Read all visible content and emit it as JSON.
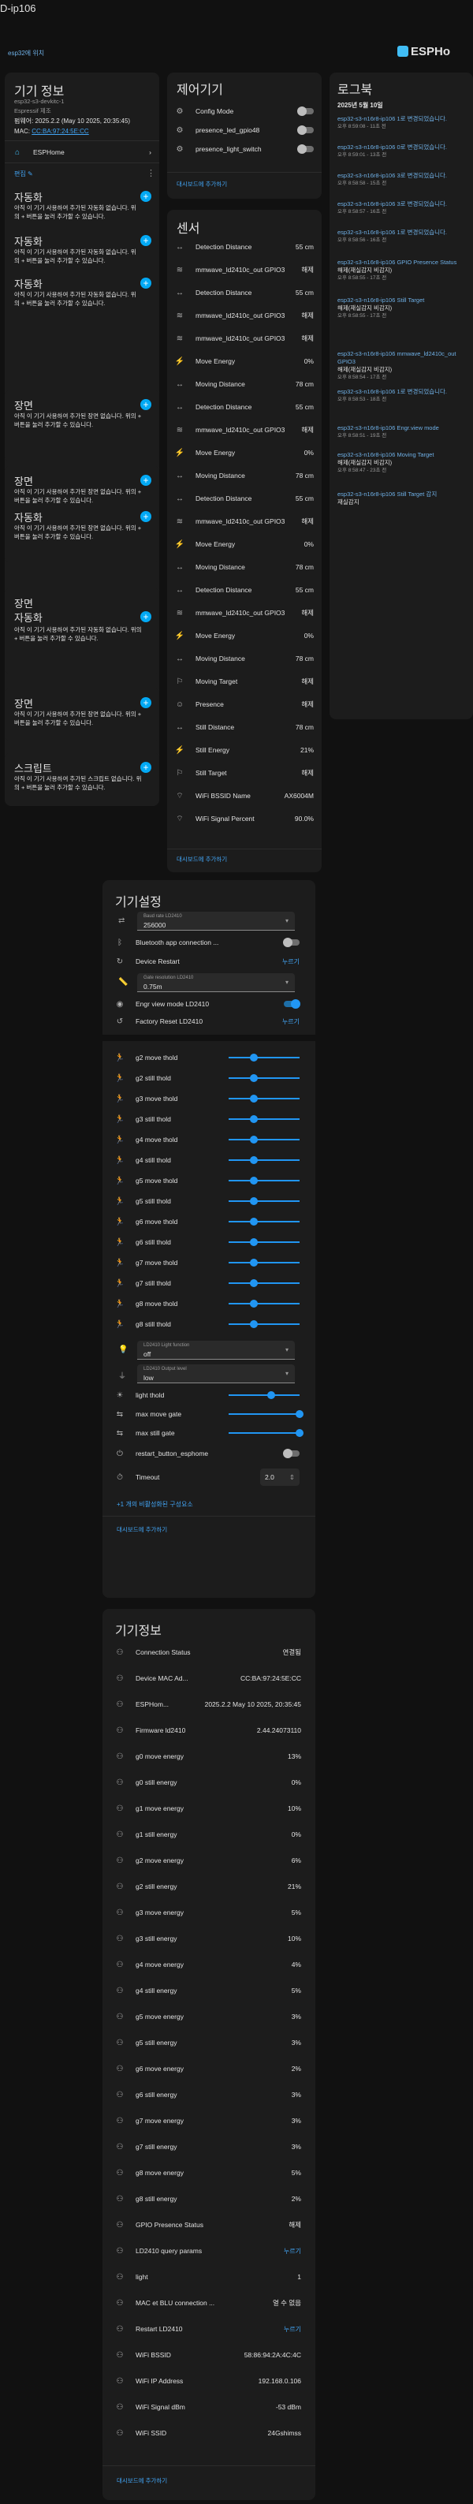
{
  "window": {
    "title": "D-ip106"
  },
  "breadcrumb": "esp32에 위치",
  "brand": {
    "name": "ESPHo"
  },
  "device_info": {
    "title": "기기 정보",
    "model": "esp32-s3-devkitc-1",
    "maker": "Espressif 제조",
    "firmware": "펌웨어: 2025.2.2 (May 10 2025, 20:35:45)",
    "mac_label": "MAC:",
    "mac_value": "CC:BA:97:24:5E:CC",
    "integration": "ESPHome",
    "edit_label": "편집",
    "automations": [
      {
        "title": "자동화",
        "desc": "아직 이 기기 사용하여 추가된 자동화 없습니다. 위의 + 버튼을 눌러 추가할 수 있습니다."
      },
      {
        "title": "자동화",
        "desc": "아직 이 기기 사용하여 추가된 자동화 없습니다. 위의 + 버튼을 눌러 추가할 수 있습니다."
      },
      {
        "title": "자동화",
        "desc": "아직 이 기기 사용하여 추가된 자동화 없습니다. 위의 + 버튼을 눌러 추가할 수 있습니다."
      }
    ],
    "scenes": [
      {
        "title": "장면",
        "subtitle": "자동화",
        "desc": "아직 이 기기 사용하여 추가된 장면 없습니다. 위의 + 버튼을 눌러 추가할 수 있습니다."
      },
      {
        "title": "장면",
        "subtitle": "자동화",
        "desc": "아직 이 기기 사용하여 추가된 장면 없습니다. 위의 + 버튼을 눌러 추가할 수 있습니다."
      },
      {
        "title": "장면",
        "subtitle": "자동화",
        "desc": "아직 이 기기 사용하여 추가된 장면 없습니다. 위의 + 버튼을 눌러 추가할 수 있습니다."
      }
    ],
    "scene_plain": {
      "title": "장면",
      "desc": "아직 이 기기 사용하여 추가된 장면 없습니다. 위의 + 버튼을 눌러 추가할 수 있습니다."
    },
    "script": {
      "title": "스크립트",
      "desc": "아직 이 기기 사용하여 추가된 스크립트 없습니다. 위의 + 버튼을 눌러 추가할 수 있습니다."
    }
  },
  "controls": {
    "title": "제어기기",
    "items": [
      {
        "icon": "wrench-icon",
        "name": "Config Mode",
        "on": false
      },
      {
        "icon": "wrench-icon",
        "name": "presence_led_gpio48",
        "on": false
      },
      {
        "icon": "wrench-icon",
        "name": "presence_light_switch",
        "on": false
      }
    ],
    "footer": "대시보드에 추가하기"
  },
  "sensors": {
    "title": "센서",
    "items": [
      {
        "name": "Detection Distance",
        "value": "55 cm"
      },
      {
        "name": "mmwave_ld2410c_out GPIO3",
        "value": "해제"
      },
      {
        "name": "Detection Distance",
        "value": "55 cm"
      },
      {
        "name": "mmwave_ld2410c_out GPIO3",
        "value": "해제"
      },
      {
        "name": "mmwave_ld2410c_out GPIO3",
        "value": "해제"
      },
      {
        "name": "Move Energy",
        "value": "0%"
      },
      {
        "name": "Moving Distance",
        "value": "78 cm"
      },
      {
        "name": "Detection Distance",
        "value": "55 cm"
      },
      {
        "name": "mmwave_ld2410c_out GPIO3",
        "value": "해제"
      },
      {
        "name": "Move Energy",
        "value": "0%"
      },
      {
        "name": "Moving Distance",
        "value": "78 cm"
      },
      {
        "name": "Detection Distance",
        "value": "55 cm"
      },
      {
        "name": "mmwave_ld2410c_out GPIO3",
        "value": "해제"
      },
      {
        "name": "Move Energy",
        "value": "0%"
      },
      {
        "name": "Moving Distance",
        "value": "78 cm"
      },
      {
        "name": "Detection Distance",
        "value": "55 cm"
      },
      {
        "name": "mmwave_ld2410c_out GPIO3",
        "value": "해제"
      },
      {
        "name": "Move Energy",
        "value": "0%"
      },
      {
        "name": "Moving Distance",
        "value": "78 cm"
      },
      {
        "name": "Moving Target",
        "value": "해제"
      },
      {
        "name": "Presence",
        "value": "해제"
      },
      {
        "name": "Still Distance",
        "value": "78 cm"
      },
      {
        "name": "Still Energy",
        "value": "21%"
      },
      {
        "name": "Still Target",
        "value": "해제"
      },
      {
        "name": "WiFi BSSID Name",
        "value": "AX6004M"
      },
      {
        "name": "WiFi Signal Percent",
        "value": "90.0%"
      }
    ],
    "footer": "대시보드에 추가하기"
  },
  "logbook": {
    "title": "로그북",
    "date": "2025년 5월 10일",
    "entries": [
      {
        "a": "esp32-s3-n16r8-ip106 1로 변경되었습니다.",
        "b": "",
        "c": "오후 8:59:08 - 11초 전"
      },
      {
        "a": "esp32-s3-n16r8-ip106 0로 변경되었습니다.",
        "b": "",
        "c": "오후 8:59:01 - 13초 전"
      },
      {
        "a": "esp32-s3-n16r8-ip106 3로 변경되었습니다.",
        "b": "",
        "c": "오후 8:58:58 - 15초 전"
      },
      {
        "a": "esp32-s3-n16r8-ip106 3로 변경되었습니다.",
        "b": "",
        "c": "오후 8:58:57 - 16초 전"
      },
      {
        "a": "esp32-s3-n16r8-ip106 1로 변경되었습니다.",
        "b": "",
        "c": "오후 8:58:56 - 16초 전"
      },
      {
        "a": "esp32-s3-n16r8-ip106 GPIO Presence Status",
        "b": "해제(재실감지 비감지)",
        "c": "오후 8:58:55 - 17초 전"
      },
      {
        "a": "esp32-s3-n16r8-ip106 Still Target",
        "b": "해제(재실감지 비감지)",
        "c": "오후 8:58:55 - 17초 전"
      },
      {
        "a": "esp32-s3-n16r8-ip106 mmwave_ld2410c_out GPIO3",
        "b": "해제(재실감지 비감지)",
        "c": "오후 8:58:54 - 17초 전"
      },
      {
        "a": "esp32-s3-n16r8-ip106 1로 변경되었습니다.",
        "b": "",
        "c": "오후 8:58:53 - 18초 전"
      },
      {
        "a": "esp32-s3-n16r8-ip106 Engr.view mode",
        "b": "",
        "c": "오후 8:58:51 - 19초 전"
      },
      {
        "a": "esp32-s3-n16r8-ip106 Moving Target",
        "b": "해제(재실감지 비감지)",
        "c": "오후 8:58:47 - 23초 전"
      },
      {
        "a": "esp32-s3-n16r8-ip106 Still Target 감지",
        "b": "재실감지",
        "c": ""
      }
    ]
  },
  "settings": {
    "title": "기기설정",
    "baud_label": "Baud rate LD2410",
    "baud_value": "256000",
    "bluetooth": "Bluetooth app connection ...",
    "device_restart": "Device Restart",
    "device_restart_action": "누르기",
    "gate_res_label": "Gate resolution LD2410",
    "gate_res_value": "0.75m",
    "engr_mode": "Engr view mode LD2410",
    "factory_reset": "Factory Reset LD2410",
    "factory_reset_action": "누르기",
    "sliders": [
      {
        "name": "g2 move thold",
        "level": 0.35
      },
      {
        "name": "g2 still thold",
        "level": 0.35
      },
      {
        "name": "g3 move thold",
        "level": 0.35
      },
      {
        "name": "g3 still thold",
        "level": 0.35
      },
      {
        "name": "g4 move thold",
        "level": 0.35
      },
      {
        "name": "g4 still thold",
        "level": 0.35
      },
      {
        "name": "g5 move thold",
        "level": 0.35
      },
      {
        "name": "g5 still thold",
        "level": 0.35
      },
      {
        "name": "g6 move thold",
        "level": 0.35
      },
      {
        "name": "g6 still thold",
        "level": 0.35
      },
      {
        "name": "g7 move thold",
        "level": 0.35
      },
      {
        "name": "g7 still thold",
        "level": 0.35
      },
      {
        "name": "g8 move thold",
        "level": 0.35
      },
      {
        "name": "g8 still thold",
        "level": 0.35
      }
    ],
    "light_fn_label": "LD2410 Light function",
    "light_fn_value": "off",
    "out_level_label": "LD2410 Output level",
    "out_level_value": "low",
    "light_thold": {
      "name": "light thold",
      "level": 0.6
    },
    "max_move_gate": {
      "name": "max move gate",
      "level": 1.0
    },
    "max_still_gate": {
      "name": "max still gate",
      "level": 1.0
    },
    "restart_button": "restart_button_esphome",
    "timeout_label": "Timeout",
    "timeout_value": "2.0",
    "hidden_note": "+1 개의 비활성화된 구성요소",
    "footer": "대시보드에 추가하기"
  },
  "diagnostic": {
    "title": "기기정보",
    "items": [
      {
        "name": "Connection Status",
        "value": "연결됨"
      },
      {
        "name": "Device MAC Ad...",
        "value": "CC:BA:97:24:5E:CC"
      },
      {
        "name": "ESPHom...",
        "value": "2025.2.2 May 10 2025, 20:35:45"
      },
      {
        "name": "Firmware ld2410",
        "value": "2.44.24073110"
      },
      {
        "name": "g0 move energy",
        "value": "13%"
      },
      {
        "name": "g0 still energy",
        "value": "0%"
      },
      {
        "name": "g1 move energy",
        "value": "10%"
      },
      {
        "name": "g1 still energy",
        "value": "0%"
      },
      {
        "name": "g2 move energy",
        "value": "6%"
      },
      {
        "name": "g2 still energy",
        "value": "21%"
      },
      {
        "name": "g3 move energy",
        "value": "5%"
      },
      {
        "name": "g3 still energy",
        "value": "10%"
      },
      {
        "name": "g4 move energy",
        "value": "4%"
      },
      {
        "name": "g4 still energy",
        "value": "5%"
      },
      {
        "name": "g5 move energy",
        "value": "3%"
      },
      {
        "name": "g5 still energy",
        "value": "3%"
      },
      {
        "name": "g6 move energy",
        "value": "2%"
      },
      {
        "name": "g6 still energy",
        "value": "3%"
      },
      {
        "name": "g7 move energy",
        "value": "3%"
      },
      {
        "name": "g7 still energy",
        "value": "3%"
      },
      {
        "name": "g8 move energy",
        "value": "5%"
      },
      {
        "name": "g8 still energy",
        "value": "2%"
      },
      {
        "name": "GPIO Presence Status",
        "value": "해제"
      },
      {
        "name": "LD2410 query params",
        "value": "누르기"
      },
      {
        "name": "light",
        "value": "1"
      },
      {
        "name": "MAC et BLU connection ...",
        "value": "열 수 없음"
      },
      {
        "name": "Restart LD2410",
        "value": "누르기"
      },
      {
        "name": "WiFi BSSID",
        "value": "58:86:94:2A:4C:4C"
      },
      {
        "name": "WiFi IP Address",
        "value": "192.168.0.106"
      },
      {
        "name": "WiFi Signal dBm",
        "value": "-53 dBm"
      },
      {
        "name": "WiFi SSID",
        "value": "24Gshimss"
      }
    ],
    "footer": "대시보드에 추가하기"
  }
}
